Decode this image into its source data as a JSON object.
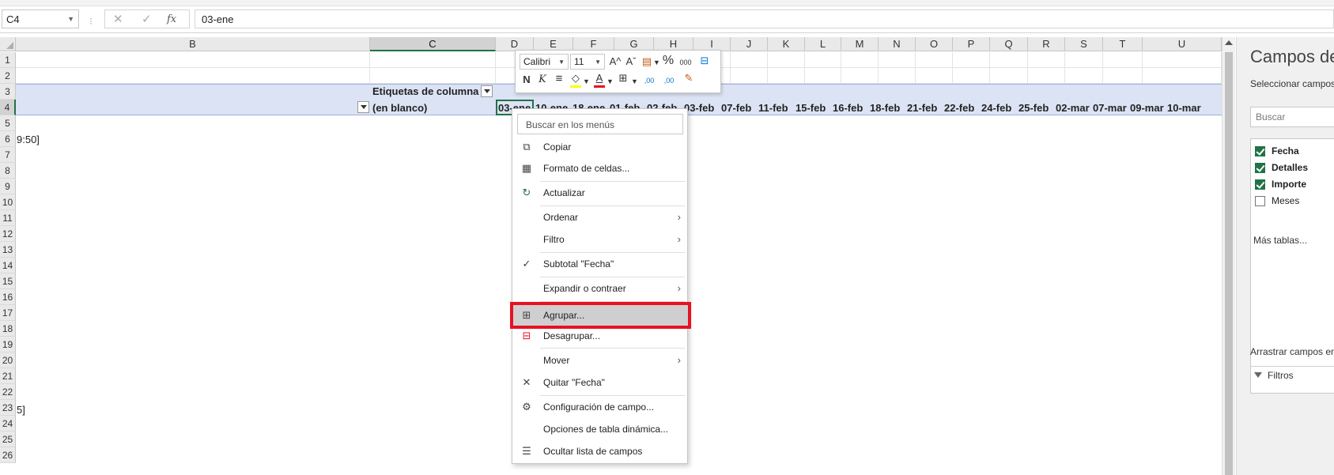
{
  "formula_bar": {
    "name_box": "C4",
    "cancel_icon": "✕",
    "enter_icon": "✓",
    "fx_label": "fx",
    "formula_value": "03-ene"
  },
  "columns": [
    "B",
    "C",
    "D",
    "E",
    "F",
    "G",
    "H",
    "I",
    "J",
    "K",
    "L",
    "M",
    "N",
    "O",
    "P",
    "Q",
    "R",
    "S",
    "T",
    "U"
  ],
  "selected_column": "C",
  "rows": [
    "1",
    "2",
    "3",
    "4",
    "5",
    "6",
    "7",
    "8",
    "9",
    "10",
    "11",
    "12",
    "13",
    "14",
    "15",
    "16",
    "17",
    "18",
    "19",
    "20",
    "21",
    "22",
    "23",
    "24",
    "25",
    "26"
  ],
  "selected_row": "4",
  "pivot": {
    "column_labels_header": "Etiquetas de columna",
    "blank_label": "(en blanco)",
    "dates": [
      "03-ene",
      "10-ene",
      "18-ene",
      "01-feb",
      "02-feb",
      "03-feb",
      "07-feb",
      "11-feb",
      "15-feb",
      "16-feb",
      "18-feb",
      "21-feb",
      "22-feb",
      "24-feb",
      "25-feb",
      "02-mar",
      "07-mar",
      "09-mar",
      "10-mar"
    ]
  },
  "cells": {
    "row6_partial": "9:50]",
    "row23_partial": "5]"
  },
  "mini_toolbar": {
    "font_name": "Calibri",
    "font_size": "11",
    "bold_label": "N",
    "italic_label": "K",
    "increase_font": "A^",
    "decrease_font": "Aˇ",
    "percent": "%",
    "thousands": "000",
    "increase_decimals": ",00",
    "decrease_decimals": ",00",
    "fill_color": "#ffff00",
    "font_color": "#e81123",
    "accent": "#0078d4"
  },
  "context_menu": {
    "search_placeholder": "Buscar en los menús",
    "items": [
      {
        "label": "Copiar",
        "icon": "copy-icon"
      },
      {
        "label": "Formato de celdas...",
        "icon": "format-cells-icon"
      },
      {
        "label": "Actualizar",
        "icon": "refresh-icon"
      },
      {
        "label": "Ordenar",
        "submenu": true
      },
      {
        "label": "Filtro",
        "submenu": true
      },
      {
        "label": "Subtotal \"Fecha\"",
        "checked": true
      },
      {
        "label": "Expandir o contraer",
        "submenu": true
      },
      {
        "label": "Agrupar...",
        "icon": "group-icon",
        "highlighted": true
      },
      {
        "label": "Desagrupar...",
        "icon": "ungroup-icon"
      },
      {
        "label": "Mover",
        "submenu": true
      },
      {
        "label": "Quitar \"Fecha\"",
        "icon": "remove-icon"
      },
      {
        "label": "Configuración de campo...",
        "icon": "field-settings-icon"
      },
      {
        "label": "Opciones de tabla dinámica..."
      },
      {
        "label": "Ocultar lista de campos",
        "icon": "field-list-icon"
      }
    ],
    "highlight_color": "#e81123"
  },
  "field_panel": {
    "title": "Campos de",
    "subtitle": "Seleccionar campos",
    "search_placeholder": "Buscar",
    "fields": [
      {
        "label": "Fecha",
        "checked": true
      },
      {
        "label": "Detalles",
        "checked": true
      },
      {
        "label": "Importe",
        "checked": true
      },
      {
        "label": "Meses",
        "checked": false
      }
    ],
    "more_tables": "Más tablas...",
    "drag_label": "Arrastrar campos en",
    "filters_label": "Filtros",
    "check_color": "#217346"
  }
}
